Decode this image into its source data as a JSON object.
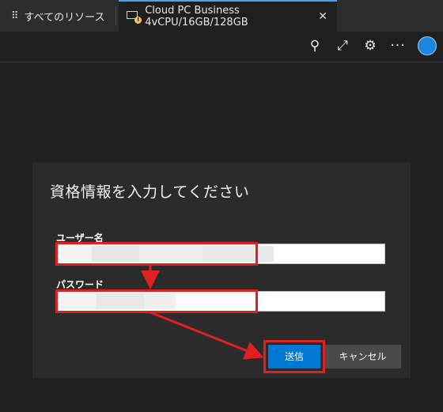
{
  "tabs": {
    "all_resources": "すべてのリソース",
    "active": "Cloud PC Business 4vCPU/16GB/128GB",
    "grid_glyph": "⠿",
    "close_glyph": "✕",
    "warn_glyph": "!"
  },
  "toolbar": {
    "pin_icon": "pin-icon",
    "expand_icon": "expand-icon",
    "gear_icon": "gear-icon",
    "more_icon": "more-icon",
    "pin_glyph": "⚲",
    "expand_glyph": "⤢",
    "gear_glyph": "⚙",
    "more_glyph": "···"
  },
  "dialog": {
    "title": "資格情報を入力してください",
    "username_label": "ユーザー名",
    "username_value": "",
    "password_label": "パスワード",
    "password_value": "",
    "submit_label": "送信",
    "cancel_label": "キャンセル"
  },
  "colors": {
    "accent": "#0078d4",
    "highlight": "#e02020",
    "tab_underline": "#4aa3e8"
  }
}
